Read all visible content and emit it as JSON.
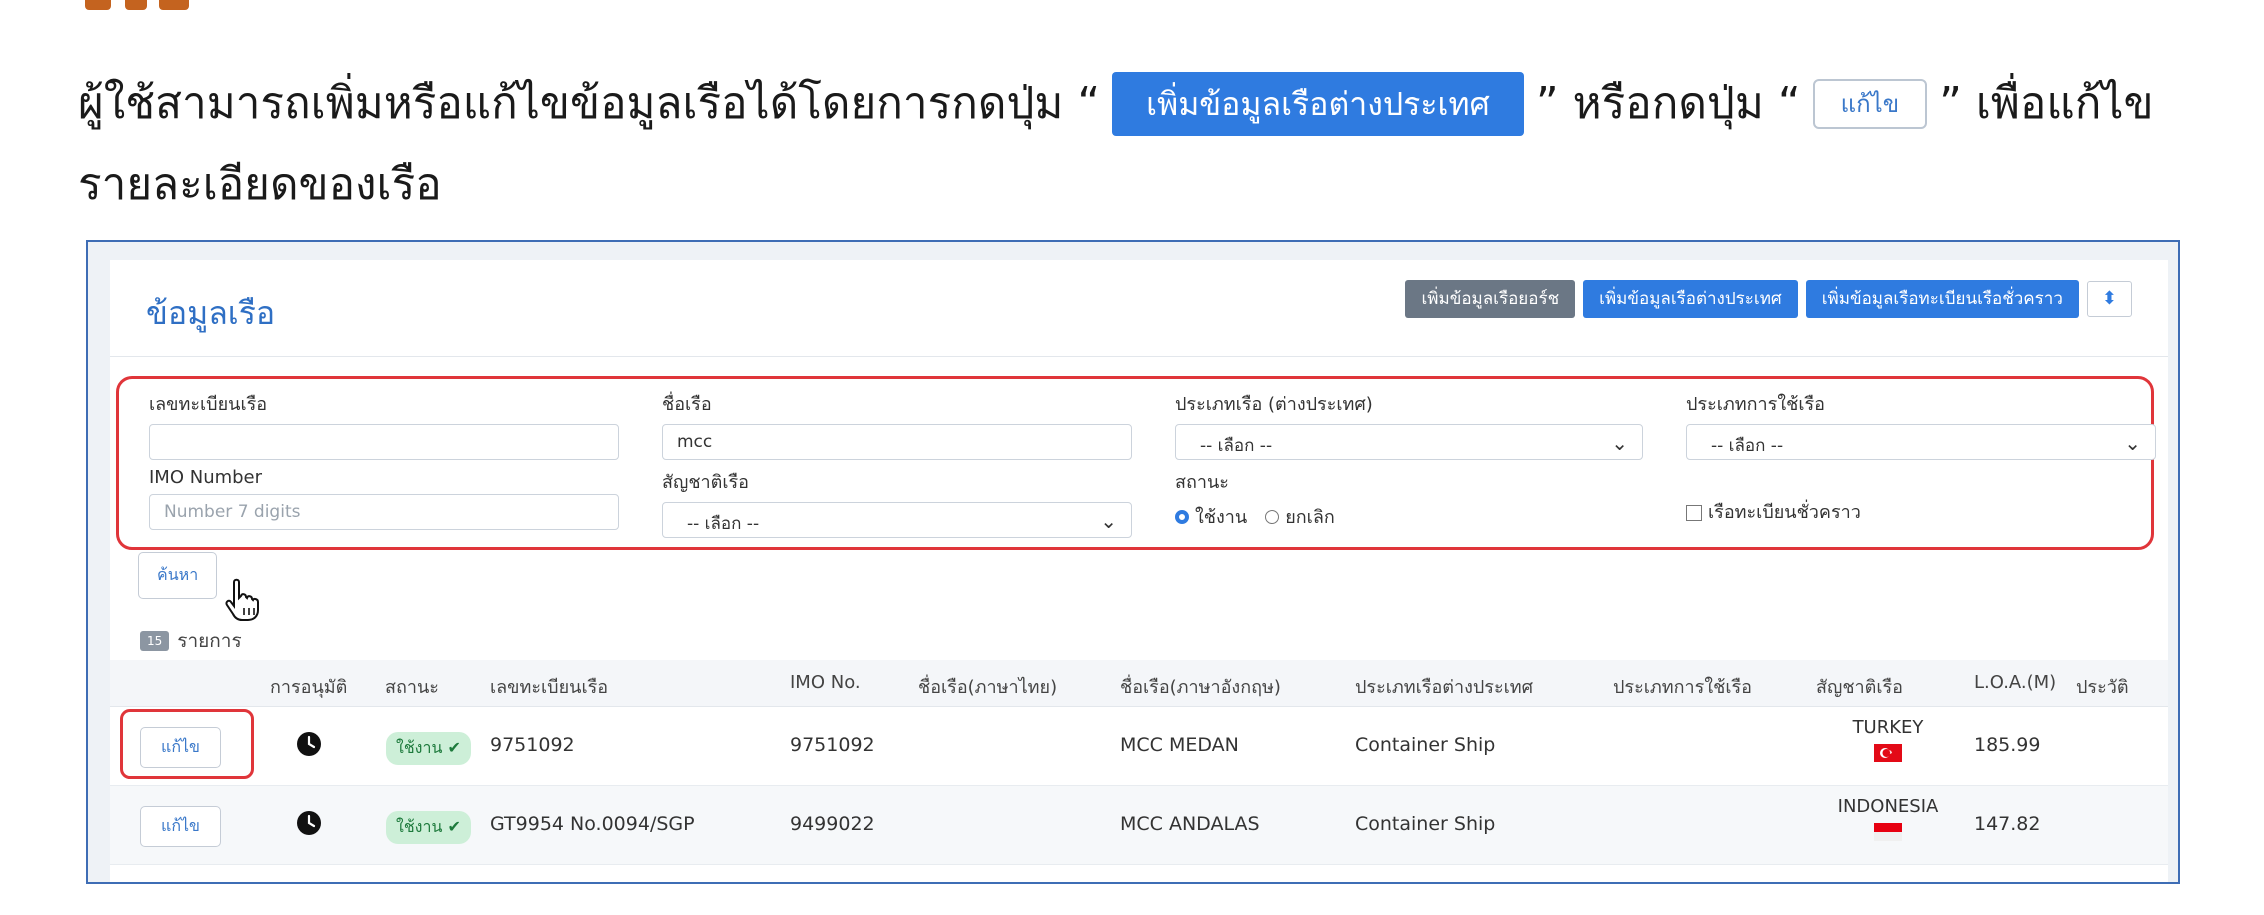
{
  "doc": {
    "line1_prefix": "ผู้ใช้สามารถเพิ่มหรือแก้ไขข้อมูลเรือได้โดยการกดปุ่ม “",
    "inline_add_button": "เพิ่มข้อมูลเรือต่างประเทศ",
    "line1_middle": "” หรือกดปุ่ม “",
    "inline_edit_button": "แก้ไข",
    "line1_suffix": "” เพื่อแก้ไข",
    "line2": "รายละเอียดของเรือ"
  },
  "page": {
    "title": "ข้อมูลเรือ",
    "actions": {
      "add_yacht": "เพิ่มข้อมูลเรือยอร์ช",
      "add_foreign": "เพิ่มข้อมูลเรือต่างประเทศ",
      "add_temporary": "เพิ่มข้อมูลเรือทะเบียนเรือชั่วคราว",
      "toggle_icon": "⬍"
    }
  },
  "filters": {
    "registration_label": "เลขทะเบียนเรือ",
    "registration_value": "",
    "ship_name_label": "ชื่อเรือ",
    "ship_name_value": "mcc",
    "ship_type_label": "ประเภทเรือ (ต่างประเทศ)",
    "ship_type_value": "-- เลือก --",
    "usage_type_label": "ประเภทการใช้เรือ",
    "usage_type_value": "-- เลือก --",
    "imo_label": "IMO Number",
    "imo_placeholder": "Number 7 digits",
    "nationality_label": "สัญชาติเรือ",
    "nationality_value": "-- เลือก --",
    "status_label": "สถานะ",
    "status_active": "ใช้งาน",
    "status_cancel": "ยกเลิก",
    "temporary_label": "เรือทะเบียนชั่วคราว",
    "search_button": "ค้นหา"
  },
  "results": {
    "count": "15",
    "count_suffix": "รายการ"
  },
  "table": {
    "headers": {
      "approval": "การอนุมัติ",
      "status": "สถานะ",
      "registration": "เลขทะเบียนเรือ",
      "imo": "IMO No.",
      "name_th": "ชื่อเรือ(ภาษาไทย)",
      "name_en": "ชื่อเรือ(ภาษาอังกฤษ)",
      "foreign_type": "ประเภทเรือต่างประเทศ",
      "usage_type": "ประเภทการใช้เรือ",
      "nationality": "สัญชาติเรือ",
      "loa": "L.O.A.(M)",
      "history": "ประวัติ"
    },
    "rows": [
      {
        "edit": "แก้ไข",
        "status": "ใช้งาน ✔",
        "registration": "9751092",
        "imo": "9751092",
        "name_th": "",
        "name_en": "MCC MEDAN",
        "foreign_type": "Container Ship",
        "usage_type": "",
        "nationality": "TURKEY",
        "loa": "185.99"
      },
      {
        "edit": "แก้ไข",
        "status": "ใช้งาน ✔",
        "registration": "GT9954 No.0094/SGP",
        "imo": "9499022",
        "name_th": "",
        "name_en": "MCC ANDALAS",
        "foreign_type": "Container Ship",
        "usage_type": "",
        "nationality": "INDONESIA",
        "loa": "147.82"
      }
    ]
  },
  "colors": {
    "accent": "#2f7be0",
    "highlight": "#e0353a",
    "status_bg": "#cdefd8",
    "status_text": "#1d7a3c"
  }
}
